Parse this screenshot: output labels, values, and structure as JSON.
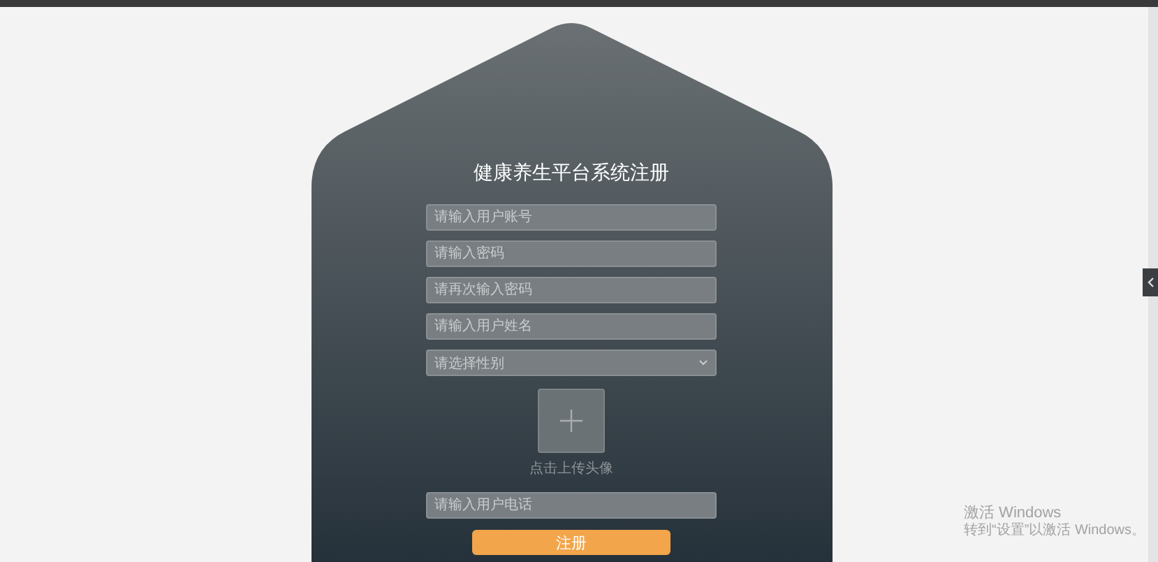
{
  "title": "健康养生平台系统注册",
  "fields": [
    {
      "kind": "text",
      "placeholder": "请输入用户账号"
    },
    {
      "kind": "text",
      "placeholder": "请输入密码"
    },
    {
      "kind": "text",
      "placeholder": "请再次输入密码"
    },
    {
      "kind": "text",
      "placeholder": "请输入用户姓名"
    },
    {
      "kind": "select",
      "placeholder": "请选择性别"
    }
  ],
  "avatar_upload": {
    "caption": "点击上传头像"
  },
  "phone_field": {
    "placeholder": "请输入用户电话"
  },
  "submit_button": {
    "label": "注册"
  },
  "activation_notice": {
    "title": "激活 Windows",
    "message": "转到“设置”以激活 Windows。"
  }
}
